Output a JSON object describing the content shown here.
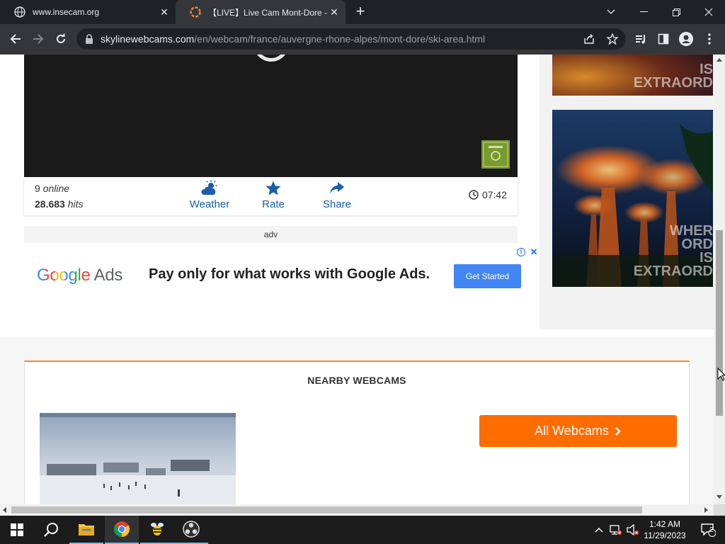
{
  "browser": {
    "tabs": [
      {
        "title": "www.insecam.org",
        "active": false
      },
      {
        "title": "【LIVE】Live Cam Mont-Dore - Fr",
        "active": true
      }
    ],
    "url_host": "skylinewebcams.com",
    "url_path": "/en/webcam/france/auvergne-rhone-alpes/mont-dore/ski-area.html"
  },
  "player": {
    "stats": {
      "online_count": "9",
      "online_label": "online",
      "hits_count": "28.683",
      "hits_label": "hits"
    },
    "actions": {
      "weather": "Weather",
      "rate": "Rate",
      "share": "Share"
    },
    "time": "07:42"
  },
  "adv_label": "adv",
  "google_ad": {
    "logo_google": "Google",
    "logo_ads": "Ads",
    "headline": "Pay only for what works with Google Ads.",
    "cta": "Get Started"
  },
  "side_ads": [
    {
      "tagline": [
        "IS",
        "EXTRAORD"
      ]
    },
    {
      "tagline": [
        "WHER",
        "ORD",
        "IS",
        "EXTRAORD"
      ]
    }
  ],
  "nearby": {
    "title": "NEARBY WEBCAMS",
    "button": "All Webcams"
  },
  "taskbar": {
    "time": "1:42 AM",
    "date": "11/29/2023",
    "notifications": "2"
  },
  "colors": {
    "accent_orange": "#ff6c00",
    "link_blue": "#1a5fa8",
    "chrome_dark": "#202124"
  }
}
